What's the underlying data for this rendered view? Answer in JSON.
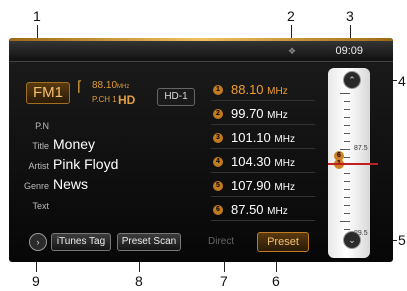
{
  "callouts": [
    "1",
    "2",
    "3",
    "4",
    "5",
    "6",
    "7",
    "8",
    "9"
  ],
  "status": {
    "time": "09:09",
    "bluetooth_icon": "bluetooth-icon"
  },
  "tuner_info": {
    "band": "FM1",
    "frequency": "88.10",
    "frequency_unit": "MHz",
    "channel": "P.CH 1",
    "hd_logo": "HD",
    "hd_channel": "HD-1"
  },
  "song_info": {
    "pn_label": "P.N",
    "title_label": "Title",
    "title": "Money",
    "artist_label": "Artist",
    "artist": "Pink Floyd",
    "genre_label": "Genre",
    "genre": "News",
    "text_label": "Text"
  },
  "presets": [
    {
      "num": "1",
      "freq": "88.10",
      "unit": "MHz"
    },
    {
      "num": "2",
      "freq": "99.70",
      "unit": "MHz"
    },
    {
      "num": "3",
      "freq": "101.10",
      "unit": "MHz"
    },
    {
      "num": "4",
      "freq": "104.30",
      "unit": "MHz"
    },
    {
      "num": "5",
      "freq": "107.90",
      "unit": "MHz"
    },
    {
      "num": "6",
      "freq": "87.50",
      "unit": "MHz"
    }
  ],
  "tuner_scale": {
    "upper_label": "87.5",
    "lower_label": "89.5",
    "marker_a": "6",
    "marker_b": "1"
  },
  "bottom_bar": {
    "itunes_tag": "iTunes Tag",
    "preset_scan": "Preset Scan",
    "direct": "Direct",
    "preset": "Preset",
    "more_icon": "chevron-right-icon"
  },
  "colors": {
    "accent": "#f0a030",
    "background": "#0a0a0a"
  }
}
